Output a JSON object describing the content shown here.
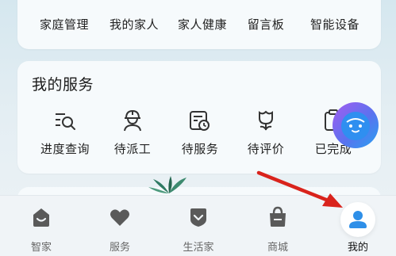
{
  "top_section": {
    "items": [
      {
        "label": "家庭管理"
      },
      {
        "label": "我的家人"
      },
      {
        "label": "家人健康"
      },
      {
        "label": "留言板"
      },
      {
        "label": "智能设备"
      }
    ]
  },
  "services": {
    "title": "我的服务",
    "items": [
      {
        "label": "进度查询",
        "icon": "search-list-icon"
      },
      {
        "label": "待派工",
        "icon": "worker-icon"
      },
      {
        "label": "待服务",
        "icon": "calendar-clock-icon"
      },
      {
        "label": "待评价",
        "icon": "flower-icon"
      },
      {
        "label": "已完成",
        "icon": "clipboard-icon"
      }
    ]
  },
  "bottom_nav": {
    "items": [
      {
        "label": "智家",
        "icon": "home-icon"
      },
      {
        "label": "服务",
        "icon": "heart-icon"
      },
      {
        "label": "生活家",
        "icon": "shield-check-icon"
      },
      {
        "label": "商城",
        "icon": "shopping-bag-icon"
      },
      {
        "label": "我的",
        "icon": "user-icon",
        "active": true
      }
    ]
  },
  "colors": {
    "accent": "#2e8fe8",
    "annotation_arrow": "#d9231c",
    "nav_icon": "#5a5a5a"
  }
}
